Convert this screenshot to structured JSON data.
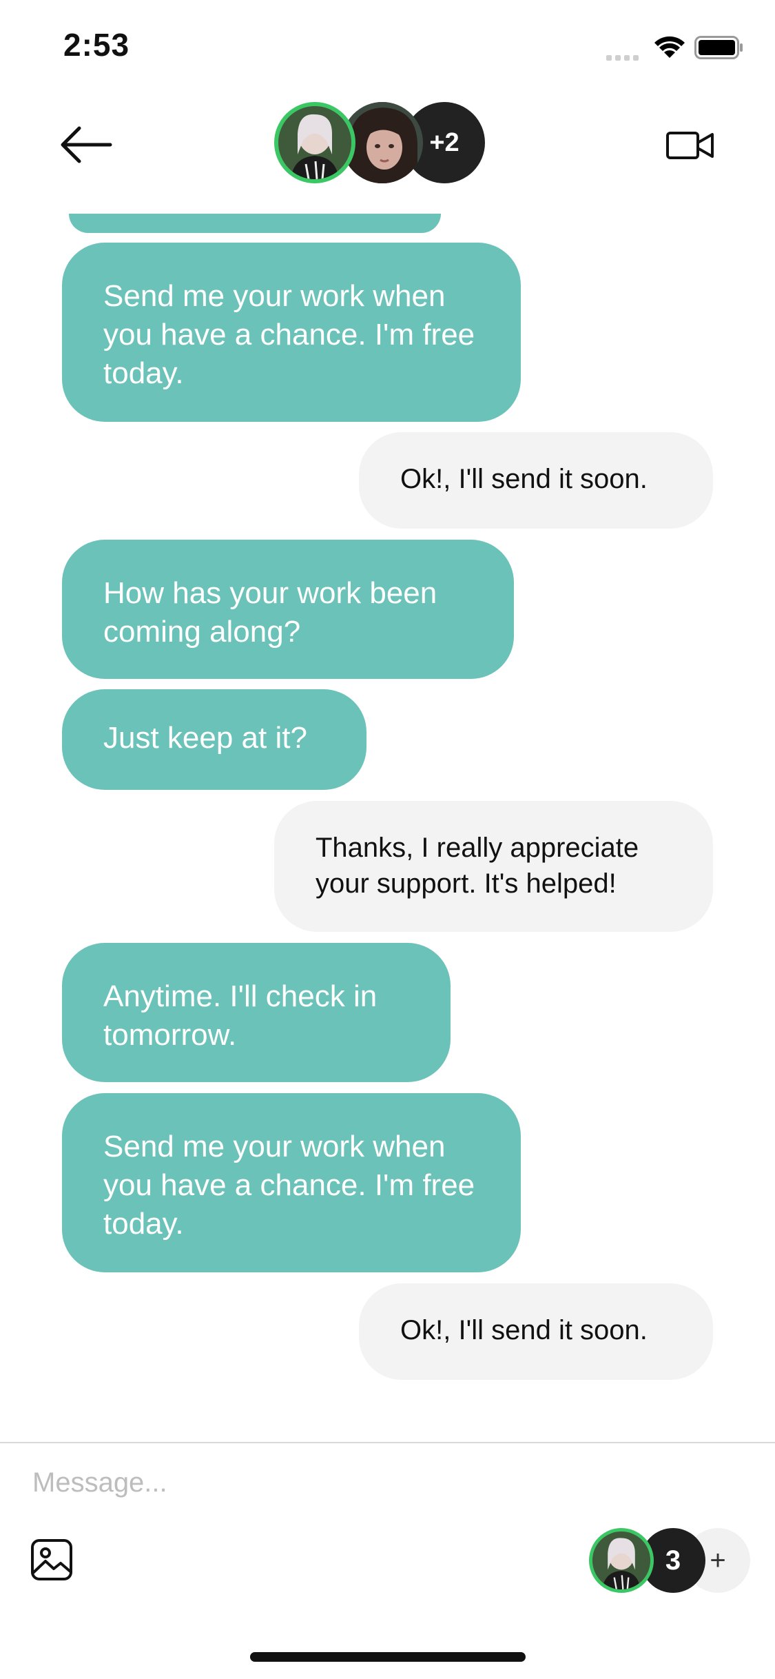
{
  "status_bar": {
    "time": "2:53"
  },
  "header": {
    "more_participants": "+2"
  },
  "messages": [
    {
      "side": "out",
      "text": "Send me your work when you have a chance. I'm free today."
    },
    {
      "side": "in",
      "text": "Ok!, I'll send it soon."
    },
    {
      "side": "out",
      "text": "How has your work been coming along?"
    },
    {
      "side": "out",
      "text": "Just keep at it?"
    },
    {
      "side": "in",
      "text": "Thanks, I really appreciate your support. It's helped!"
    },
    {
      "side": "out",
      "text": "Anytime. I'll check in tomorrow."
    },
    {
      "side": "out",
      "text": "Send me your work when you have a chance. I'm free today."
    },
    {
      "side": "in",
      "text": "Ok!, I'll send it soon."
    }
  ],
  "composer": {
    "placeholder": "Message...",
    "participants_count": "3",
    "add_label": "+"
  },
  "colors": {
    "outgoing_bubble": "#6bc2b8",
    "incoming_bubble": "#f3f3f3",
    "online_ring": "#3ac764"
  },
  "icons": [
    "back-arrow-icon",
    "video-camera-icon",
    "gallery-icon",
    "wifi-icon",
    "battery-icon",
    "signal-icon"
  ]
}
